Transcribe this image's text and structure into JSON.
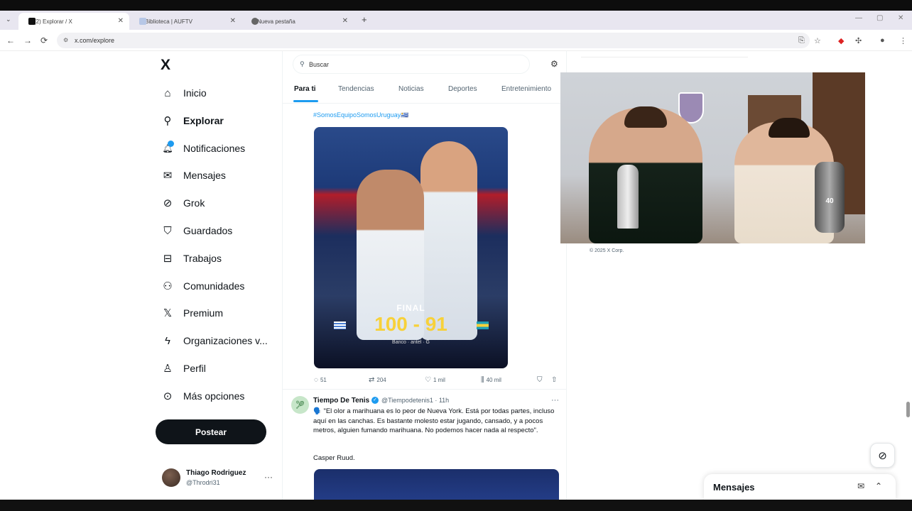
{
  "browser": {
    "tabs": [
      {
        "label": "(2) Explorar / X",
        "active": true
      },
      {
        "label": "Biblioteca | AUFTV",
        "active": false
      },
      {
        "label": "Nueva pestaña",
        "active": false
      }
    ],
    "new_tab": "+",
    "url": "x.com/explore",
    "nav": {
      "back": "←",
      "forward": "→",
      "reload": "⟳"
    }
  },
  "sidebar": {
    "logo": "X",
    "items": [
      {
        "label": "Inicio",
        "icon": "home-icon",
        "glyph": "⌂"
      },
      {
        "label": "Explorar",
        "icon": "search-icon",
        "glyph": "⚲"
      },
      {
        "label": "Notificaciones",
        "icon": "bell-icon",
        "glyph": "🔔︎"
      },
      {
        "label": "Mensajes",
        "icon": "mail-icon",
        "glyph": "✉"
      },
      {
        "label": "Grok",
        "icon": "grok-icon",
        "glyph": "⊘"
      },
      {
        "label": "Guardados",
        "icon": "bookmark-icon",
        "glyph": "⛉"
      },
      {
        "label": "Trabajos",
        "icon": "briefcase-icon",
        "glyph": "⊟"
      },
      {
        "label": "Comunidades",
        "icon": "community-icon",
        "glyph": "⚇"
      },
      {
        "label": "Premium",
        "icon": "x-premium-icon",
        "glyph": "𝕏"
      },
      {
        "label": "Organizaciones v...",
        "icon": "lightning-icon",
        "glyph": "ϟ"
      },
      {
        "label": "Perfil",
        "icon": "person-icon",
        "glyph": "♙"
      },
      {
        "label": "Más opciones",
        "icon": "more-circle-icon",
        "glyph": "⊙"
      }
    ],
    "post_button": "Postear",
    "user": {
      "name": "Thiago Rodriguez",
      "handle": "@Throdri31",
      "more": "···"
    }
  },
  "main": {
    "search_placeholder": "Buscar",
    "tabs": [
      "Para ti",
      "Tendencias",
      "Noticias",
      "Deportes",
      "Entretenimiento"
    ],
    "tweet1": {
      "hashtag": "#SomosEquipoSomosUruguay🇺🇾",
      "image_text": {
        "final": "FINAL",
        "score": "100 - 91",
        "sponsors": "Banco · antel · G"
      },
      "actions": {
        "replies": "51",
        "reposts": "204",
        "likes": "1 mil",
        "views": "40 mil"
      }
    },
    "tweet2": {
      "name": "Tiempo De Tenis",
      "handle": "@Tiempodetenis1 · 11h",
      "text": "🗣️ \"El olor a marihuana es lo peor de Nueva York. Está por todas partes, incluso aquí en las canchas. Es bastante molesto estar jugando, cansado, y a pocos metros, alguien fumando marihuana. No podemos hacer nada al respecto\".",
      "author_line": "Casper Ruud."
    }
  },
  "right": {
    "copyright": "© 2025 X Corp.",
    "webcam_overlay_text": "40"
  },
  "messages_drawer": {
    "title": "Mensajes"
  }
}
